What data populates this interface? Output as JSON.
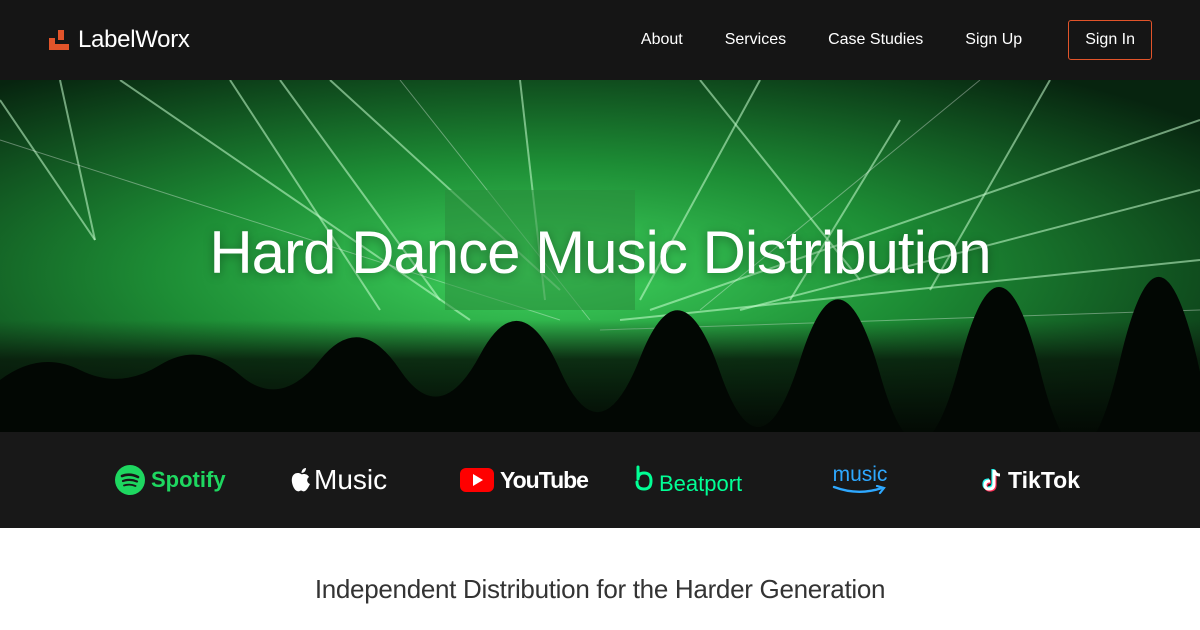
{
  "brand": {
    "name": "LabelWorx",
    "accent": "#e2542a"
  },
  "nav": {
    "items": [
      "About",
      "Services",
      "Case Studies",
      "Sign Up"
    ],
    "signin": "Sign In"
  },
  "hero": {
    "title": "Hard Dance Music Distribution",
    "tint": "#1f8f3a"
  },
  "platforms": {
    "spotify": "Spotify",
    "apple_music": "Music",
    "youtube": "YouTube",
    "beatport": "Beatport",
    "amazon_music": "music",
    "tiktok": "TikTok"
  },
  "tagline": "Independent Distribution for the Harder Generation"
}
